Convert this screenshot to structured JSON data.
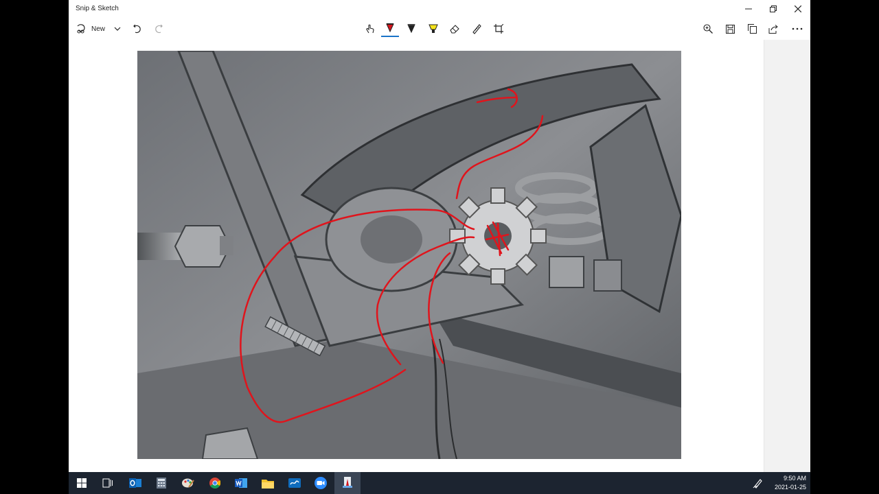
{
  "window": {
    "title": "Snip & Sketch",
    "controls": {
      "minimize": "minimize-icon",
      "maximize": "maximize-icon",
      "close": "close-icon"
    }
  },
  "toolbar": {
    "new_label": "New",
    "left_tools": [
      "new-snip-icon",
      "chevron-down-icon",
      "undo-icon",
      "redo-icon"
    ],
    "center_tools": [
      "touch-writing-icon",
      "ballpoint-pen-icon",
      "pencil-icon",
      "highlighter-icon",
      "eraser-icon",
      "ruler-icon",
      "crop-icon"
    ],
    "right_tools": [
      "zoom-icon",
      "save-icon",
      "copy-icon",
      "share-icon",
      "more-icon"
    ],
    "active_pen_color": "#d4141c",
    "highlighter_color": "#f5e31a"
  },
  "taskbar": {
    "apps": [
      "start-icon",
      "task-view-icon",
      "outlook-icon",
      "calculator-icon",
      "paint-icon",
      "chrome-icon",
      "word-icon",
      "file-explorer-icon",
      "whiteboard-icon",
      "zoom-app-icon",
      "snip-sketch-icon"
    ],
    "clock_time": "9:50 AM",
    "clock_date": "2021-01-25"
  }
}
